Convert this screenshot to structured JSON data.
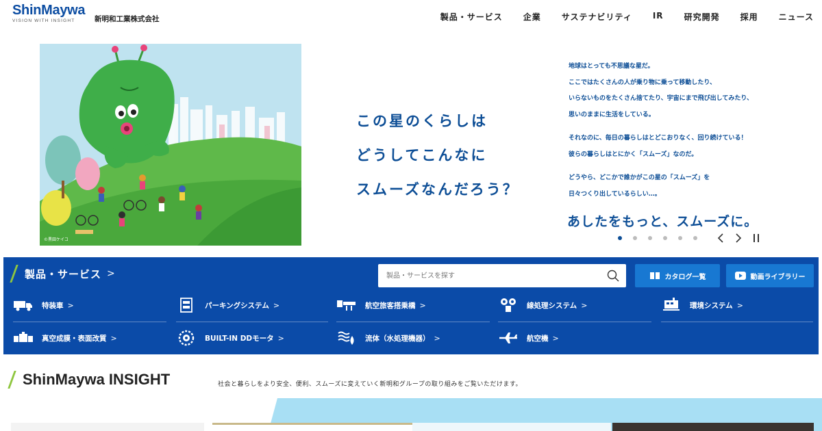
{
  "header": {
    "logo_main": "ShinMaywa",
    "logo_tagline": "VISION WITH INSIGHT",
    "company_name": "新明和工業株式会社",
    "nav": [
      "製品・サービス",
      "企業",
      "サステナビリティ",
      "IR",
      "研究開発",
      "採用",
      "ニュース"
    ]
  },
  "hero": {
    "illustration_credit": "©黒田ケイコ",
    "headline": [
      "この星のくらしは",
      "どうしてこんなに",
      "スムーズなんだろう？"
    ],
    "body": [
      "地球はとっても不思議な星だ。",
      "ここではたくさんの人が乗り物に乗って移動したり、",
      "いらないものをたくさん捨てたり、宇宙にまで飛び出してみたり、",
      "思いのままに生活をしている。",
      "それなのに、毎日の暮らしはとどこおりなく、回り続けている！",
      "彼らの暮らしはとにかく「スムーズ」なのだ。",
      "どうやら、どこかで誰かがこの星の「スムーズ」を",
      "日々つくり出しているらしい…。"
    ],
    "tagline": "あしたをもっと、スムーズに。",
    "carousel": {
      "slide_count": 6,
      "active_index": 0
    }
  },
  "products": {
    "title": "製品・サービス",
    "search_placeholder": "製品・サービスを探す",
    "catalog_label": "カタログ一覧",
    "video_label": "動画ライブラリー",
    "categories": [
      {
        "label": "特装車",
        "icon": "truck-icon"
      },
      {
        "label": "パーキングシステム",
        "icon": "parking-icon"
      },
      {
        "label": "航空旅客搭乗橋",
        "icon": "boarding-bridge-icon"
      },
      {
        "label": "線処理システム",
        "icon": "wire-processing-icon"
      },
      {
        "label": "環境システム",
        "icon": "environment-icon"
      },
      {
        "label": "真空成膜・表面改質",
        "icon": "vacuum-icon"
      },
      {
        "label": "BUILT-IN DDモータ",
        "icon": "motor-icon"
      },
      {
        "label": "流体（水処理機器）",
        "icon": "fluid-icon"
      },
      {
        "label": "航空機",
        "icon": "aircraft-icon"
      }
    ]
  },
  "insight": {
    "title": "ShinMaywa INSIGHT",
    "description": "社会と暮らしをより安全、便利、スムーズに変えていく新明和グループの取り組みをご覧いただけます。"
  },
  "colors": {
    "brand_blue": "#0b4ba8",
    "text_blue": "#0d4e96",
    "button_blue": "#1878d2",
    "accent_green": "#8ec63f"
  }
}
